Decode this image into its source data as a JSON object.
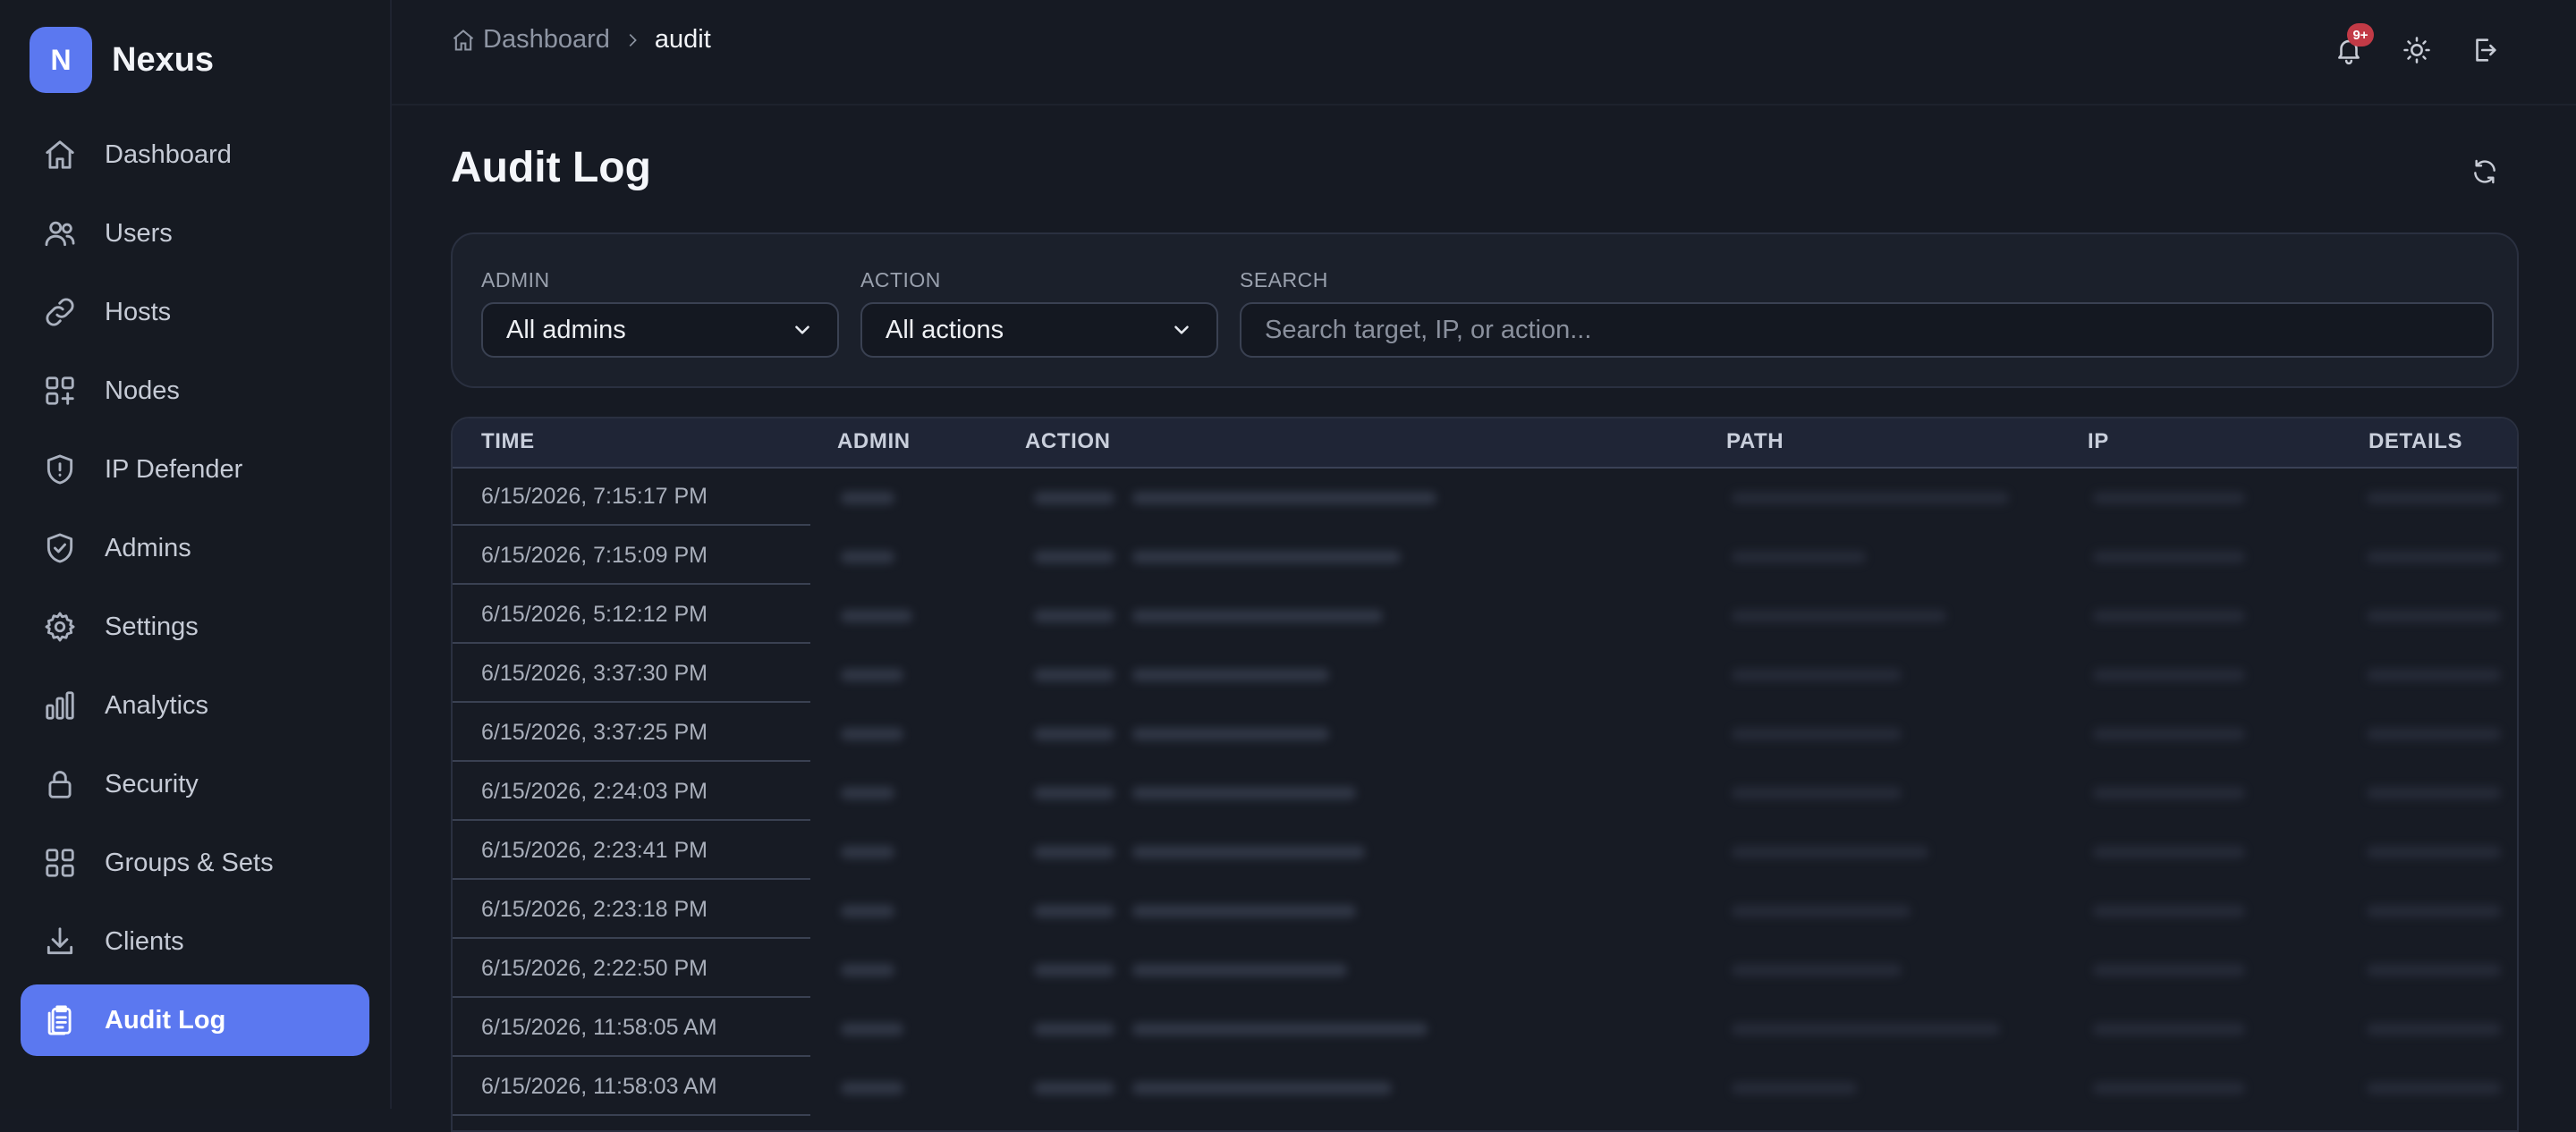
{
  "brand": {
    "initial": "N",
    "name": "Nexus"
  },
  "sidebar": {
    "items": [
      {
        "label": "Dashboard",
        "icon": "home-icon"
      },
      {
        "label": "Users",
        "icon": "users-icon"
      },
      {
        "label": "Hosts",
        "icon": "link-icon"
      },
      {
        "label": "Nodes",
        "icon": "nodes-icon"
      },
      {
        "label": "IP Defender",
        "icon": "shield-alert-icon"
      },
      {
        "label": "Admins",
        "icon": "shield-check-icon"
      },
      {
        "label": "Settings",
        "icon": "gear-icon"
      },
      {
        "label": "Analytics",
        "icon": "bar-chart-icon"
      },
      {
        "label": "Security",
        "icon": "lock-icon"
      },
      {
        "label": "Groups & Sets",
        "icon": "grid-icon"
      },
      {
        "label": "Clients",
        "icon": "download-icon"
      },
      {
        "label": "Audit Log",
        "icon": "clipboard-icon",
        "active": true
      }
    ]
  },
  "breadcrumb": {
    "home": "Dashboard",
    "current": "audit"
  },
  "header": {
    "notification_badge": "9+"
  },
  "page": {
    "title": "Audit Log"
  },
  "filters": {
    "admin_label": "ADMIN",
    "admin_value": "All admins",
    "action_label": "ACTION",
    "action_value": "All actions",
    "search_label": "SEARCH",
    "search_placeholder": "Search target, IP, or action..."
  },
  "table": {
    "columns": [
      "TIME",
      "ADMIN",
      "ACTION",
      "PATH",
      "IP",
      "DETAILS"
    ],
    "rows": [
      "6/15/2026, 7:15:17 PM",
      "6/15/2026, 7:15:09 PM",
      "6/15/2026, 5:12:12 PM",
      "6/15/2026, 3:37:30 PM",
      "6/15/2026, 3:37:25 PM",
      "6/15/2026, 2:24:03 PM",
      "6/15/2026, 2:23:41 PM",
      "6/15/2026, 2:23:18 PM",
      "6/15/2026, 2:22:50 PM",
      "6/15/2026, 11:58:05 AM",
      "6/15/2026, 11:58:03 AM"
    ]
  },
  "colors": {
    "accent": "#5b78f0",
    "background": "#161a23",
    "badge": "#c23a46"
  }
}
